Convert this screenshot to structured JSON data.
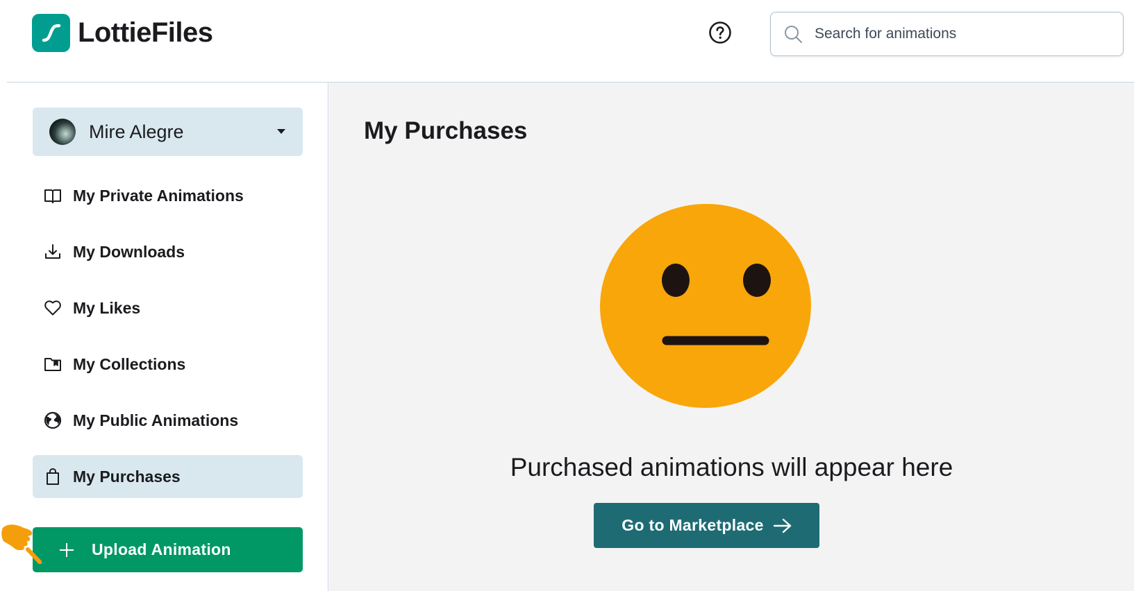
{
  "header": {
    "logo_text": "LottieFiles",
    "search": {
      "placeholder": "Search for animations"
    }
  },
  "sidebar": {
    "user": {
      "name": "Mire Alegre"
    },
    "items": [
      {
        "label": "My Private Animations",
        "icon": "book-open-icon"
      },
      {
        "label": "My Downloads",
        "icon": "download-icon"
      },
      {
        "label": "My Likes",
        "icon": "heart-icon"
      },
      {
        "label": "My Collections",
        "icon": "folder-bookmark-icon"
      },
      {
        "label": "My Public Animations",
        "icon": "globe-icon"
      },
      {
        "label": "My Purchases",
        "icon": "shopping-bag-icon",
        "active": true
      }
    ],
    "upload_label": "Upload Animation"
  },
  "main": {
    "title": "My Purchases",
    "empty_message": "Purchased animations will appear here",
    "cta_label": "Go to Marketplace"
  },
  "colors": {
    "brand_teal": "#019d91",
    "upload_green": "#019866",
    "cta_teal": "#1e6b73",
    "active_bg": "#d9e8ef",
    "emoji_yellow": "#f9a60a",
    "main_bg": "#f3f3f3"
  }
}
